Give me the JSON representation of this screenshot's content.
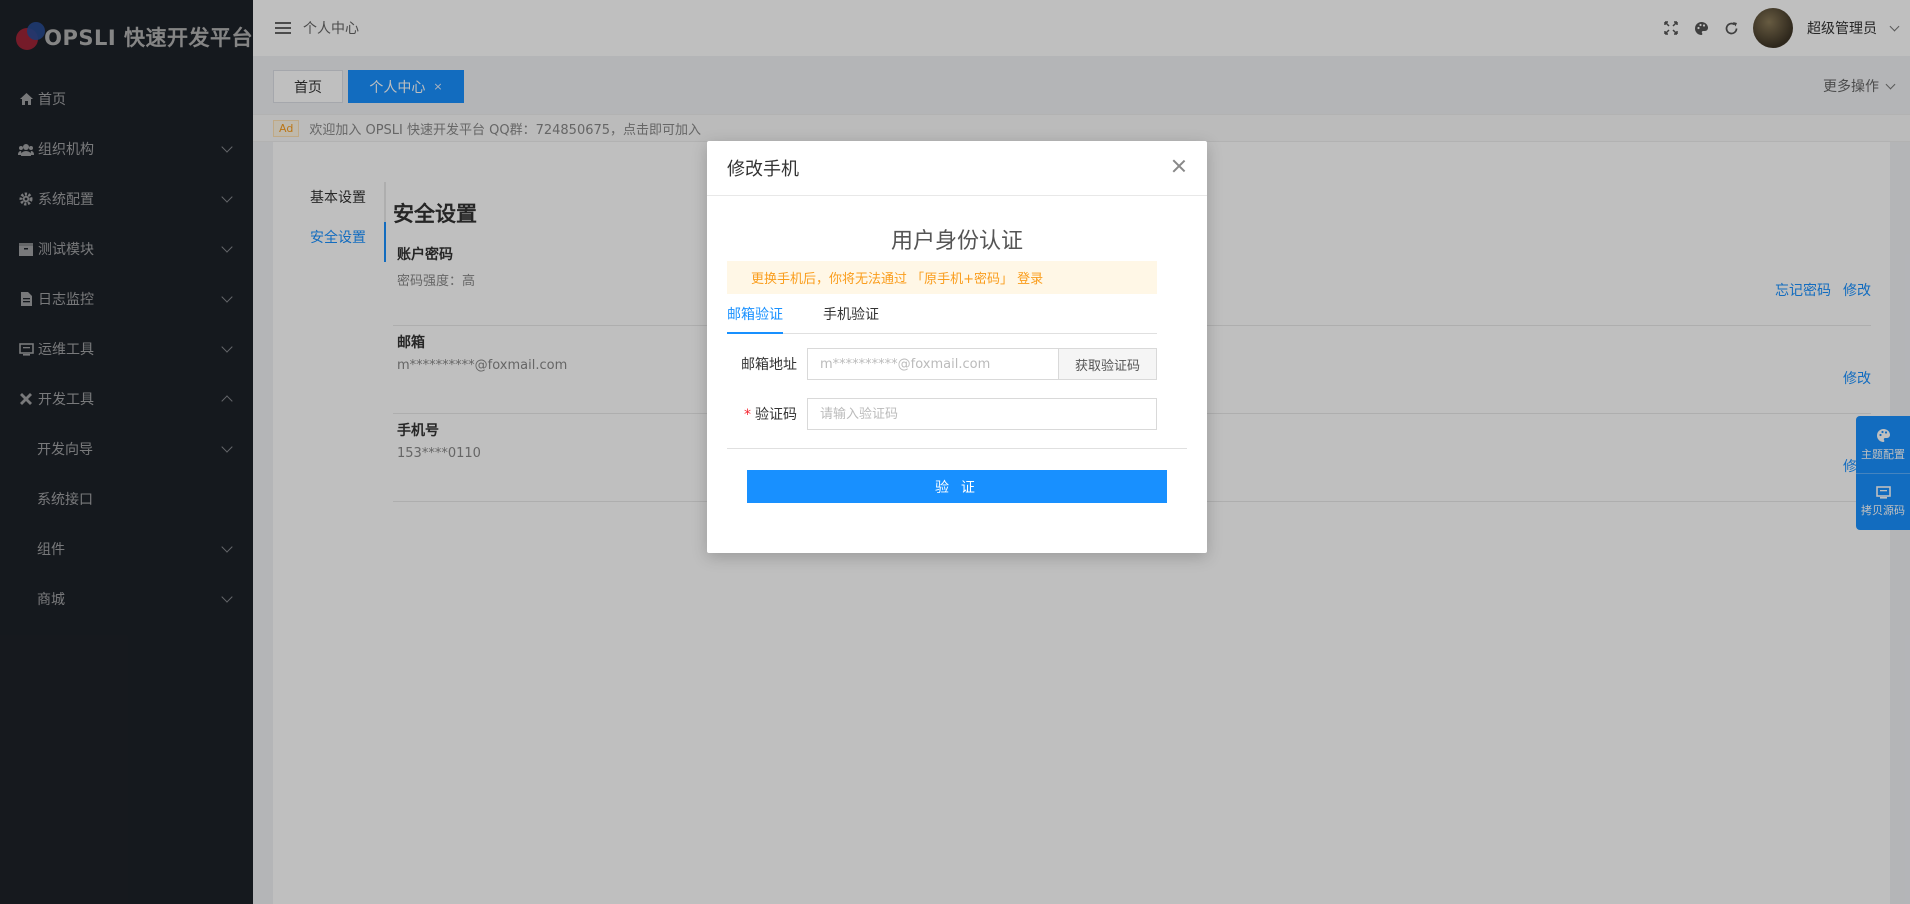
{
  "brand": {
    "name": "OPSLI 快速开发平台"
  },
  "sidebar": {
    "items": [
      {
        "label": "首页",
        "icon": "home-icon",
        "has_children": false
      },
      {
        "label": "组织机构",
        "icon": "users-icon",
        "has_children": true
      },
      {
        "label": "系统配置",
        "icon": "gear-icon",
        "has_children": true
      },
      {
        "label": "测试模块",
        "icon": "box-icon",
        "has_children": true
      },
      {
        "label": "日志监控",
        "icon": "log-icon",
        "has_children": true
      },
      {
        "label": "运维工具",
        "icon": "monitor-icon",
        "has_children": true
      },
      {
        "label": "开发工具",
        "icon": "tools-icon",
        "has_children": true,
        "expanded": true
      },
      {
        "label": "开发向导",
        "sub": true,
        "has_children": true
      },
      {
        "label": "系统接口",
        "sub": true,
        "has_children": false
      },
      {
        "label": "组件",
        "sub": true,
        "has_children": true
      },
      {
        "label": "商城",
        "sub": true,
        "has_children": true
      }
    ]
  },
  "header": {
    "breadcrumb": "个人中心",
    "user_name": "超级管理员",
    "icons": [
      "fullscreen-icon",
      "palette-icon",
      "refresh-icon"
    ]
  },
  "tabs": {
    "home": "首页",
    "active": "个人中心",
    "close_glyph": "×",
    "more_ops": "更多操作"
  },
  "notice": {
    "tag": "Ad",
    "text": "欢迎加入 OPSLI 快速开发平台 QQ群：724850675，点击即可加入"
  },
  "profile": {
    "sub_nav": [
      "基本设置",
      "安全设置"
    ],
    "section_title": "安全设置",
    "rows": [
      {
        "title": "账户密码",
        "desc": "密码强度：高",
        "actions": [
          "忘记密码",
          "修改"
        ]
      },
      {
        "title": "邮箱",
        "desc": "m**********@foxmail.com",
        "actions": [
          "修改"
        ]
      },
      {
        "title": "手机号",
        "desc": "153****0110",
        "actions": [
          "修改"
        ]
      }
    ]
  },
  "float_buttons": [
    {
      "label": "主题配置",
      "icon": "palette-icon"
    },
    {
      "label": "拷贝源码",
      "icon": "monitor-icon"
    }
  ],
  "modal": {
    "title": "修改手机",
    "auth_title": "用户身份认证",
    "warning": "更换手机后，你将无法通过 「原手机+密码」 登录",
    "tabs": [
      "邮箱验证",
      "手机验证"
    ],
    "email_label": "邮箱地址",
    "email_placeholder": "m**********@foxmail.com",
    "get_code": "获取验证码",
    "code_label": "验证码",
    "code_placeholder": "请输入验证码",
    "submit": "验 证"
  },
  "colors": {
    "primary": "#1890ff",
    "sidebar": "#2a303a",
    "warning": "#fa9d1c"
  }
}
